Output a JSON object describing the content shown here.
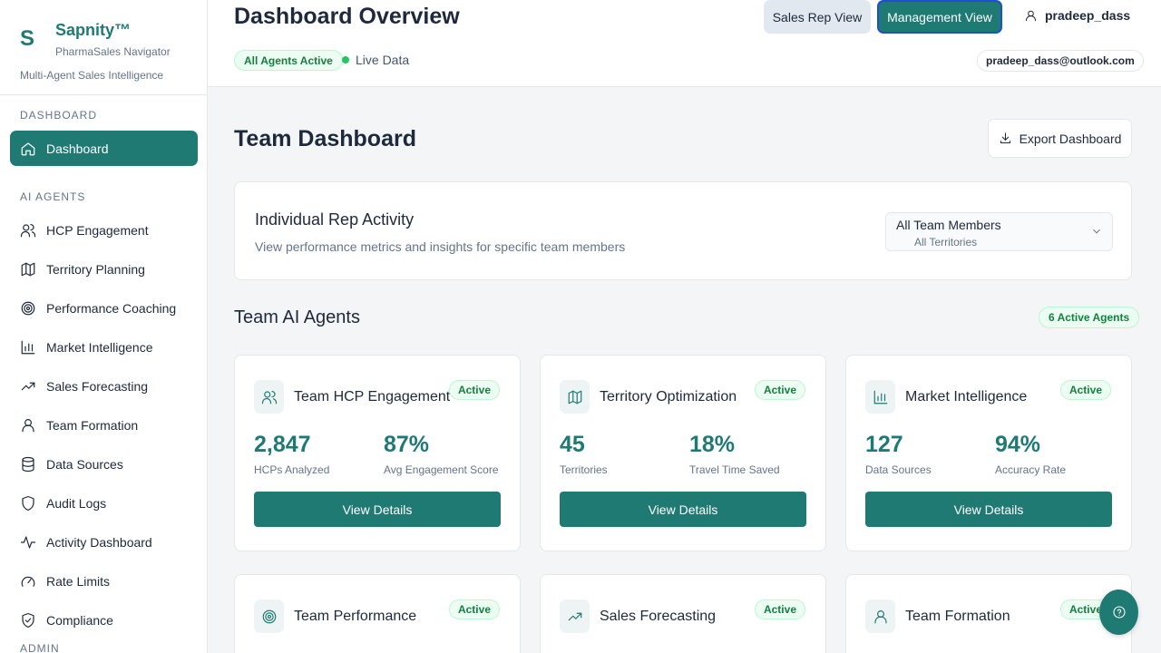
{
  "brand": {
    "logo_letter": "S",
    "name": "Sapnity™",
    "subtitle": "PharmaSales Navigator",
    "tagline": "Multi-Agent Sales Intelligence"
  },
  "sidebar": {
    "sections": [
      {
        "label": "DASHBOARD"
      },
      {
        "label": "AI AGENTS"
      },
      {
        "label": "ADMIN"
      }
    ],
    "items": [
      {
        "label": "Dashboard",
        "icon": "home-icon",
        "active": true
      },
      {
        "label": "HCP Engagement",
        "icon": "users-icon"
      },
      {
        "label": "Territory Planning",
        "icon": "map-icon"
      },
      {
        "label": "Performance Coaching",
        "icon": "target-icon"
      },
      {
        "label": "Market Intelligence",
        "icon": "bar-chart-icon"
      },
      {
        "label": "Sales Forecasting",
        "icon": "trending-up-icon"
      },
      {
        "label": "Team Formation",
        "icon": "user-icon"
      },
      {
        "label": "Data Sources",
        "icon": "database-icon"
      },
      {
        "label": "Audit Logs",
        "icon": "shield-icon"
      },
      {
        "label": "Activity Dashboard",
        "icon": "activity-icon"
      },
      {
        "label": "Rate Limits",
        "icon": "gauge-icon"
      },
      {
        "label": "Compliance",
        "icon": "shield-check-icon"
      }
    ]
  },
  "header": {
    "title": "Dashboard Overview",
    "status_badge": "All Agents Active",
    "live_label": "Live Data",
    "sales_rep_view": "Sales Rep View",
    "management_view": "Management View",
    "username": "pradeep_dass",
    "email": "pradeep_dass@outlook.com"
  },
  "main": {
    "title": "Team Dashboard",
    "export_label": "Export Dashboard",
    "rep_activity": {
      "title": "Individual Rep Activity",
      "description": "View performance metrics and insights for specific team members",
      "select_value": "All Team Members",
      "select_sub": "All Territories"
    },
    "agents_title": "Team AI Agents",
    "agents_count": "6 Active Agents",
    "agents": [
      {
        "name": "Team HCP Engagement",
        "icon": "users-icon",
        "status": "Active",
        "metrics": [
          {
            "value": "2,847",
            "label": "HCPs Analyzed"
          },
          {
            "value": "87%",
            "label": "Avg Engagement Score"
          }
        ],
        "button": "View Details"
      },
      {
        "name": "Territory Optimization",
        "icon": "map-icon",
        "status": "Active",
        "metrics": [
          {
            "value": "45",
            "label": "Territories"
          },
          {
            "value": "18%",
            "label": "Travel Time Saved"
          }
        ],
        "button": "View Details"
      },
      {
        "name": "Market Intelligence",
        "icon": "bar-chart-icon",
        "status": "Active",
        "metrics": [
          {
            "value": "127",
            "label": "Data Sources"
          },
          {
            "value": "94%",
            "label": "Accuracy Rate"
          }
        ],
        "button": "View Details"
      },
      {
        "name": "Team Performance",
        "icon": "target-icon",
        "status": "Active"
      },
      {
        "name": "Sales Forecasting",
        "icon": "trending-up-icon",
        "status": "Active"
      },
      {
        "name": "Team Formation",
        "icon": "user-icon",
        "status": "Active"
      }
    ]
  },
  "colors": {
    "primary": "#1f7a74",
    "active_green": "#15803d",
    "focus_border": "#1d4ed8"
  },
  "help_icon": "help-circle-icon"
}
